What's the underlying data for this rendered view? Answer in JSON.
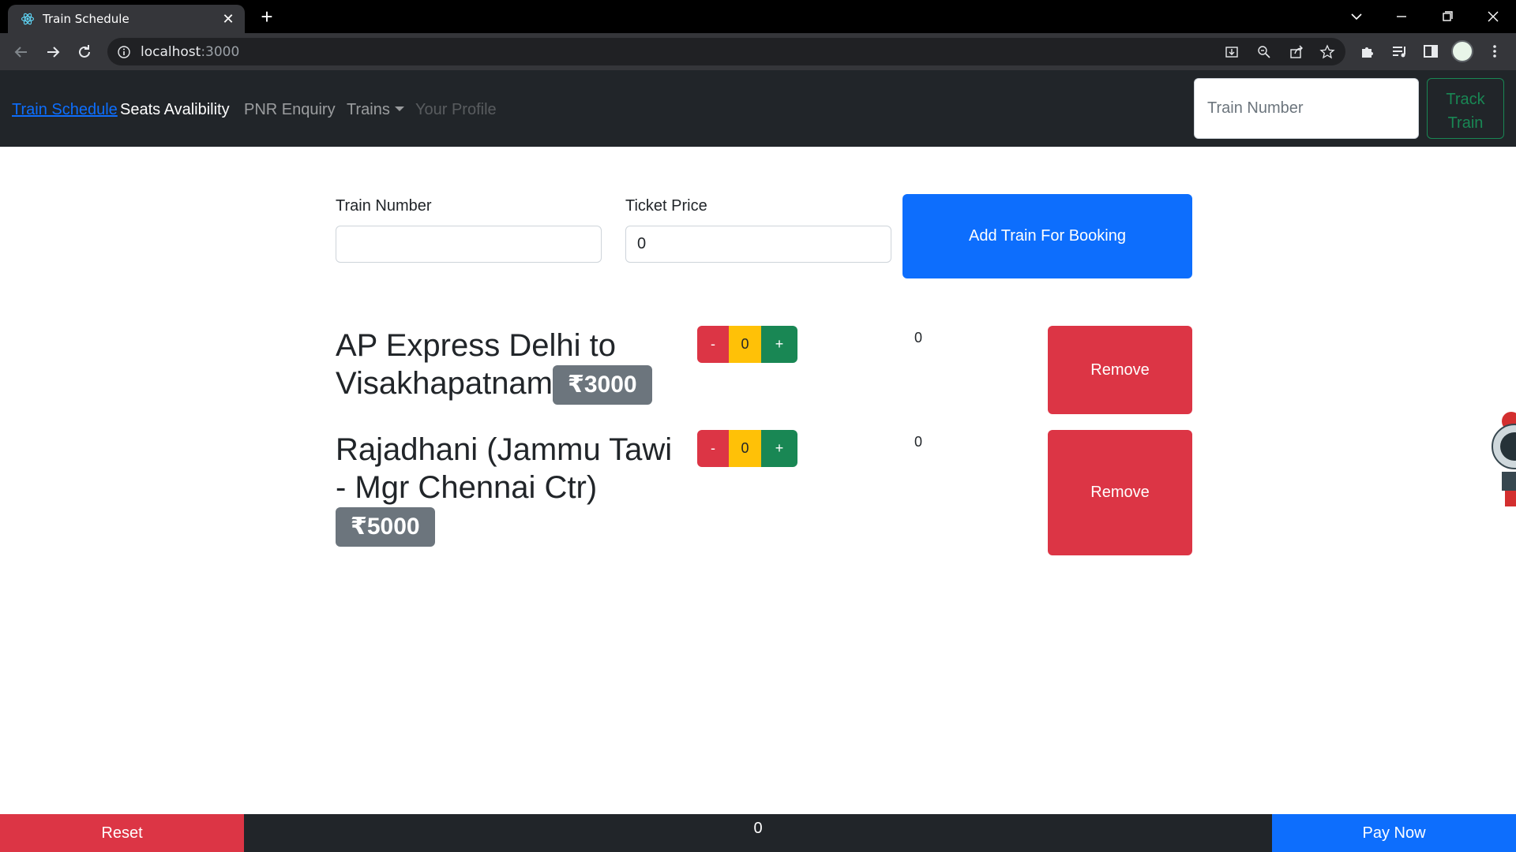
{
  "browser": {
    "tab_title": "Train Schedule",
    "url_host": "localhost",
    "url_port": ":3000"
  },
  "navbar": {
    "brand": "Train Schedule",
    "links": [
      "Seats Avalibility",
      "PNR Enquiry",
      "Trains",
      "Your Profile"
    ],
    "search_placeholder": "Train Number",
    "track_button": "Track Train"
  },
  "form": {
    "train_number_label": "Train Number",
    "train_number_value": "",
    "ticket_price_label": "Ticket Price",
    "ticket_price_value": "0",
    "add_button": "Add Train For Booking"
  },
  "trains": [
    {
      "name": "AP Express Delhi to Visakhapatnam",
      "price": "₹3000",
      "minus": "-",
      "qty": "0",
      "plus": "+",
      "total": "0",
      "remove": "Remove"
    },
    {
      "name": "Rajadhani (Jammu Tawi - Mgr Chennai Ctr)",
      "price": "₹5000",
      "minus": "-",
      "qty": "0",
      "plus": "+",
      "total": "0",
      "remove": "Remove"
    }
  ],
  "footer": {
    "reset": "Reset",
    "total": "0",
    "pay": "Pay Now"
  },
  "colors": {
    "primary": "#0d6efd",
    "danger": "#dc3545",
    "warning": "#ffc107",
    "success": "#198754",
    "secondary": "#6c757d",
    "dark": "#212529"
  }
}
